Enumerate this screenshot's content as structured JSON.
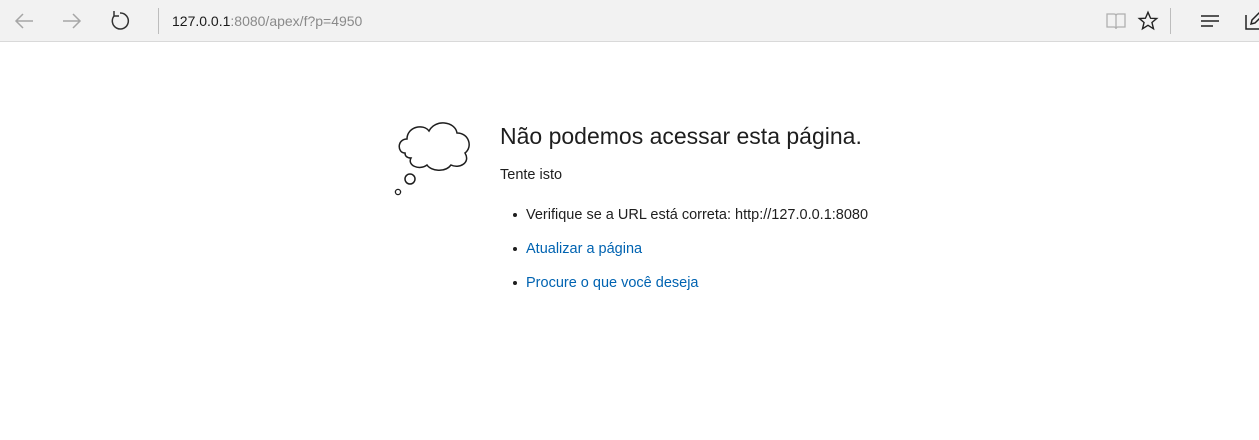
{
  "browser": {
    "back_icon": "arrow-left-icon",
    "forward_icon": "arrow-right-icon",
    "refresh_icon": "refresh-icon",
    "address_host": "127.0.0.1",
    "address_rest": ":8080/apex/f?p=4950",
    "reading_view_icon": "book-icon",
    "favorite_icon": "star-icon",
    "hub_icon": "hamburger-icon",
    "note_icon": "pen-icon"
  },
  "error_page": {
    "illustration": "thought-cloud-icon",
    "title": "Não podemos acessar esta página.",
    "try_label": "Tente isto",
    "suggestions": [
      {
        "text": "Verifique se a URL está correta: http://127.0.0.1:8080",
        "link": false
      },
      {
        "text": "Atualizar a página",
        "link": true
      },
      {
        "text": "Procure o que você deseja",
        "link": true
      }
    ]
  },
  "colors": {
    "toolbar_bg": "#f2f2f2",
    "link": "#0063b1",
    "text": "#1e1e1e"
  }
}
